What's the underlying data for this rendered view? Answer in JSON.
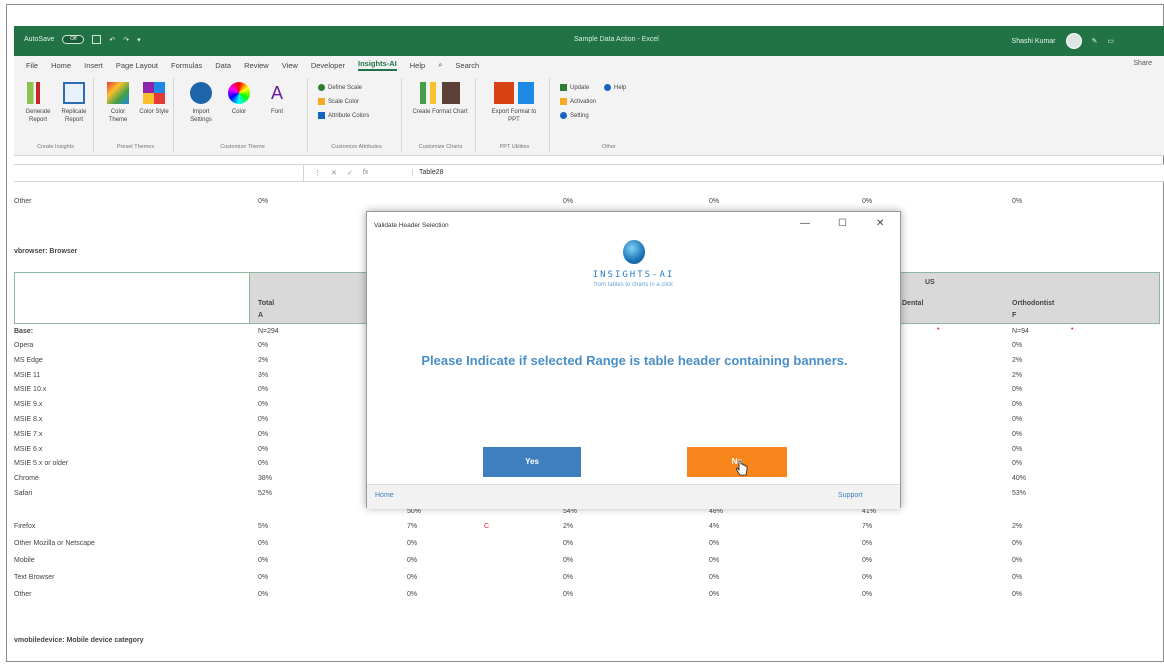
{
  "titlebar": {
    "autosave": "AutoSave",
    "toggle": "Off",
    "doc_title": "Sample Data Action - Excel",
    "user": "Shashi Kumar"
  },
  "menu": {
    "tabs": [
      "File",
      "Home",
      "Insert",
      "Page Layout",
      "Formulas",
      "Data",
      "Review",
      "View",
      "Developer",
      "Insights-AI",
      "Help"
    ],
    "search": "Search",
    "share": "Share"
  },
  "ribbon": {
    "generate_report": "Generate Report",
    "replicate_report": "Replicate Report",
    "group_create_insights": "Create Insights",
    "color_theme": "Color Theme",
    "color_style": "Color Style",
    "group_preset_themes": "Preset Themes",
    "import_settings": "Import Settings",
    "color": "Color",
    "font": "Font",
    "group_customize_theme": "Customize Theme",
    "define_scale": "Define Scale",
    "scale_color": "Scale Color",
    "attribute_colors": "Attribute Colors",
    "group_customize_attributes": "Customize Attributes",
    "create_format_chart": "Create Format Chart",
    "group_customize_charts": "Customize Charts",
    "export_format_ppt": "Export Format to PPT",
    "group_ppt_utilities": "PPT Utilities",
    "update": "Update",
    "help": "Help",
    "activation": "Activation",
    "setting": "Setting",
    "group_other": "Other"
  },
  "formula": {
    "value": "Table28"
  },
  "sheet": {
    "top_other_label": "Other",
    "top_other_values": [
      "0%",
      "0%",
      "0%",
      "0%",
      "0%",
      "0%"
    ],
    "section_title": "vbrowser: Browser",
    "header_total": "Total",
    "header_total_letter": "A",
    "header_us": "US",
    "header_dental": "Dental",
    "header_ortho": "Orthodontist",
    "header_ortho_letter": "F",
    "base_label": "Base:",
    "base_total": "N=294",
    "base_ortho": "N=94",
    "rows_upper": [
      {
        "label": "Opera",
        "total": "0%",
        "ortho": "0%"
      },
      {
        "label": "MS Edge",
        "total": "2%",
        "ortho": "2%"
      },
      {
        "label": "MSIE 11",
        "total": "3%",
        "ortho": "2%"
      },
      {
        "label": "MSIE 10.x",
        "total": "0%",
        "ortho": "0%"
      },
      {
        "label": "MSIE 9.x",
        "total": "0%",
        "ortho": "0%"
      },
      {
        "label": "MSIE 8.x",
        "total": "0%",
        "ortho": "0%"
      },
      {
        "label": "MSIE 7.x",
        "total": "0%",
        "ortho": "0%"
      },
      {
        "label": "MSIE 6.x",
        "total": "0%",
        "ortho": "0%"
      },
      {
        "label": "MSIE 5.x or older",
        "total": "0%",
        "ortho": "0%"
      },
      {
        "label": "Chrome",
        "total": "38%",
        "ortho": "40%"
      },
      {
        "label": "Safari",
        "total": "52%",
        "ortho": "53%"
      }
    ],
    "rows_lower": [
      {
        "label": "Firefox",
        "v": [
          "5%",
          "7%",
          "2%",
          "4%",
          "7%",
          "2%"
        ]
      },
      {
        "label": "Other Mozilla or Netscape",
        "v": [
          "0%",
          "0%",
          "0%",
          "0%",
          "0%",
          "0%"
        ]
      },
      {
        "label": "Mobile",
        "v": [
          "0%",
          "0%",
          "0%",
          "0%",
          "0%",
          "0%"
        ]
      },
      {
        "label": "Text Browser",
        "v": [
          "0%",
          "0%",
          "0%",
          "0%",
          "0%",
          "0%"
        ]
      },
      {
        "label": "Other",
        "v": [
          "0%",
          "0%",
          "0%",
          "0%",
          "0%",
          "0%"
        ]
      }
    ],
    "safari_partial": [
      "50%",
      "54%",
      "48%",
      "41%"
    ],
    "firefox_mark": "C",
    "bottom_section": "vmobiledevice: Mobile device category"
  },
  "dialog": {
    "title": "Validate Header Selection",
    "logo_text": "INSIGHTS-AI",
    "tagline": "from tables to charts in a click",
    "message": "Please Indicate if selected Range is table header containing banners.",
    "yes": "Yes",
    "no": "No",
    "home": "Home",
    "support": "Support"
  },
  "colors": {
    "excel_green": "#217346",
    "yes_blue": "#3d7fbf",
    "no_orange": "#f7861c",
    "message_blue": "#4a8fc7"
  }
}
